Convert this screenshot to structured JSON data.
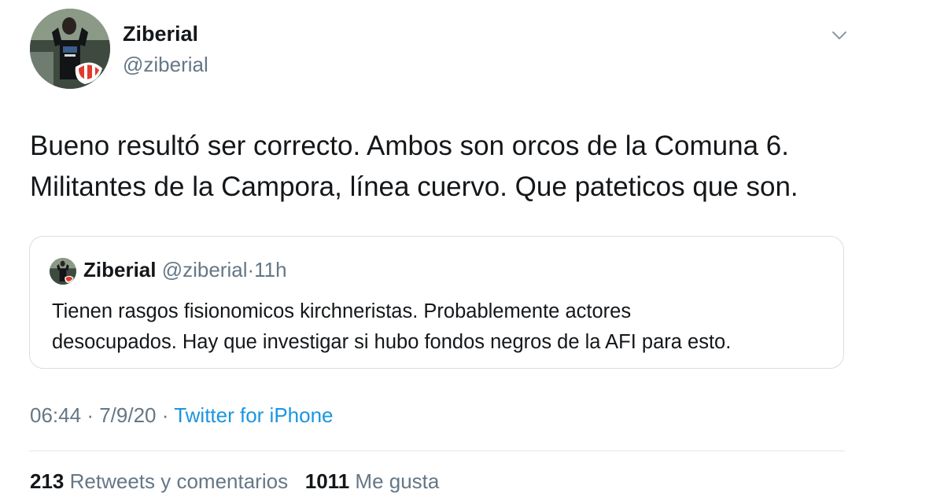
{
  "author": {
    "name": "Ziberial",
    "handle": "@ziberial"
  },
  "tweet": {
    "lines": [
      "Bueno resultó ser correcto. Ambos son orcos de la Comuna 6.",
      "Militantes de la Campora, línea cuervo. Que pateticos que son."
    ]
  },
  "quoted": {
    "name": "Ziberial",
    "handle": "@ziberial",
    "separator": "·",
    "time": "11h",
    "lines": [
      "Tienen rasgos fisionomicos kirchneristas. Probablemente actores",
      "desocupados. Hay que investigar si hubo fondos negros de la AFI para esto."
    ]
  },
  "meta": {
    "time": "06:44",
    "separator": "·",
    "date": "7/9/20",
    "source": "Twitter for iPhone"
  },
  "stats": {
    "retweets_count": "213",
    "retweets_label": "Retweets y comentarios",
    "likes_count": "1011",
    "likes_label": "Me gusta"
  },
  "icons": {
    "caret": "chevron-down-icon"
  },
  "colors": {
    "text": "#14171a",
    "secondary": "#657786",
    "link": "#1b95e0",
    "border": "#d8dee3"
  }
}
